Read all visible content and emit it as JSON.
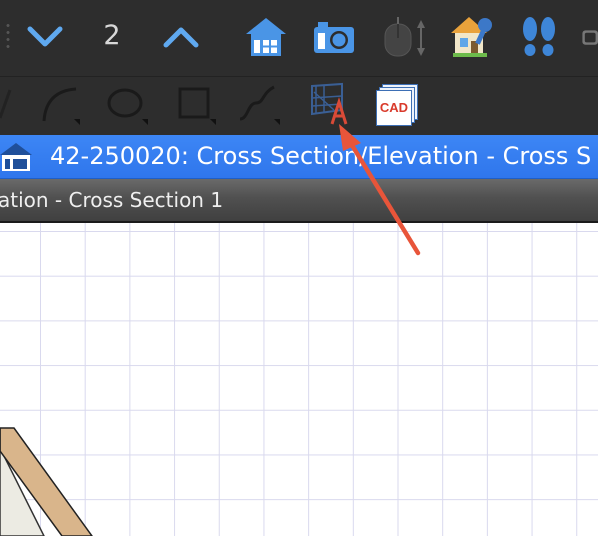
{
  "toolbar": {
    "floor_down_icon": "chevron-down-icon",
    "floor_number": "2",
    "floor_up_icon": "chevron-up-icon"
  },
  "drawing_tools": {
    "cad_label": "CAD"
  },
  "window": {
    "title": "42-250020: Cross Section/Elevation - Cross S",
    "tab_label": "ation - Cross Section 1"
  },
  "colors": {
    "accent_blue": "#2f76ec",
    "annotation_arrow": "#e8553a",
    "toolbar_bg": "#2d2d2d"
  }
}
